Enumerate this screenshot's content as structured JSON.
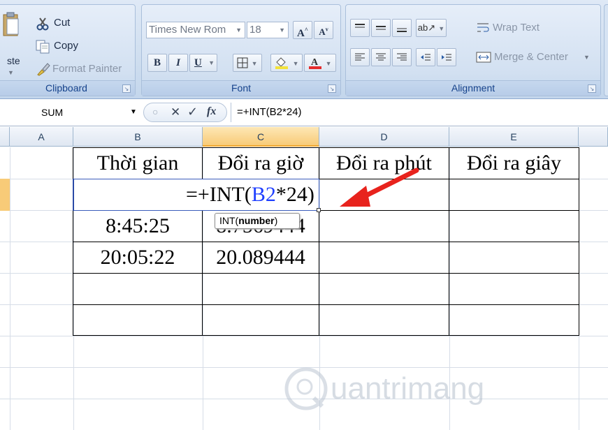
{
  "ribbon": {
    "clipboard": {
      "label": "Clipboard",
      "paste_label": "ste",
      "cut_label": "Cut",
      "copy_label": "Copy",
      "format_painter_label": "Format Painter"
    },
    "font": {
      "label": "Font",
      "font_name": "Times New Rom",
      "font_size": "18",
      "bold": "B",
      "italic": "I",
      "underline": "U"
    },
    "alignment": {
      "label": "Alignment",
      "wrap_text_label": "Wrap Text",
      "merge_center_label": "Merge & Center"
    }
  },
  "formula_bar": {
    "name_box": "SUM",
    "fx": "fx",
    "formula": "=+INT(B2*24)"
  },
  "columns": [
    "A",
    "B",
    "C",
    "D",
    "E"
  ],
  "active_column": "C",
  "table": {
    "headers": [
      "Thời gian",
      "Đổi ra giờ",
      "Đổi ra phút",
      "Đổi ra giây"
    ],
    "editing_formula": {
      "prefix": "=+INT(",
      "ref": "B2",
      "suffix": "*24)"
    },
    "rows": [
      [
        "8:45:25",
        "8.7569444"
      ],
      [
        "20:05:22",
        "20.089444"
      ]
    ]
  },
  "tooltip": {
    "fn": "INT(",
    "arg": "number",
    "close": ")"
  },
  "watermark": {
    "text": "uantrimang"
  },
  "colors": {
    "ref_blue": "#1f3fff",
    "arrow_red": "#e8231d",
    "active_header": "#f8cb78"
  }
}
